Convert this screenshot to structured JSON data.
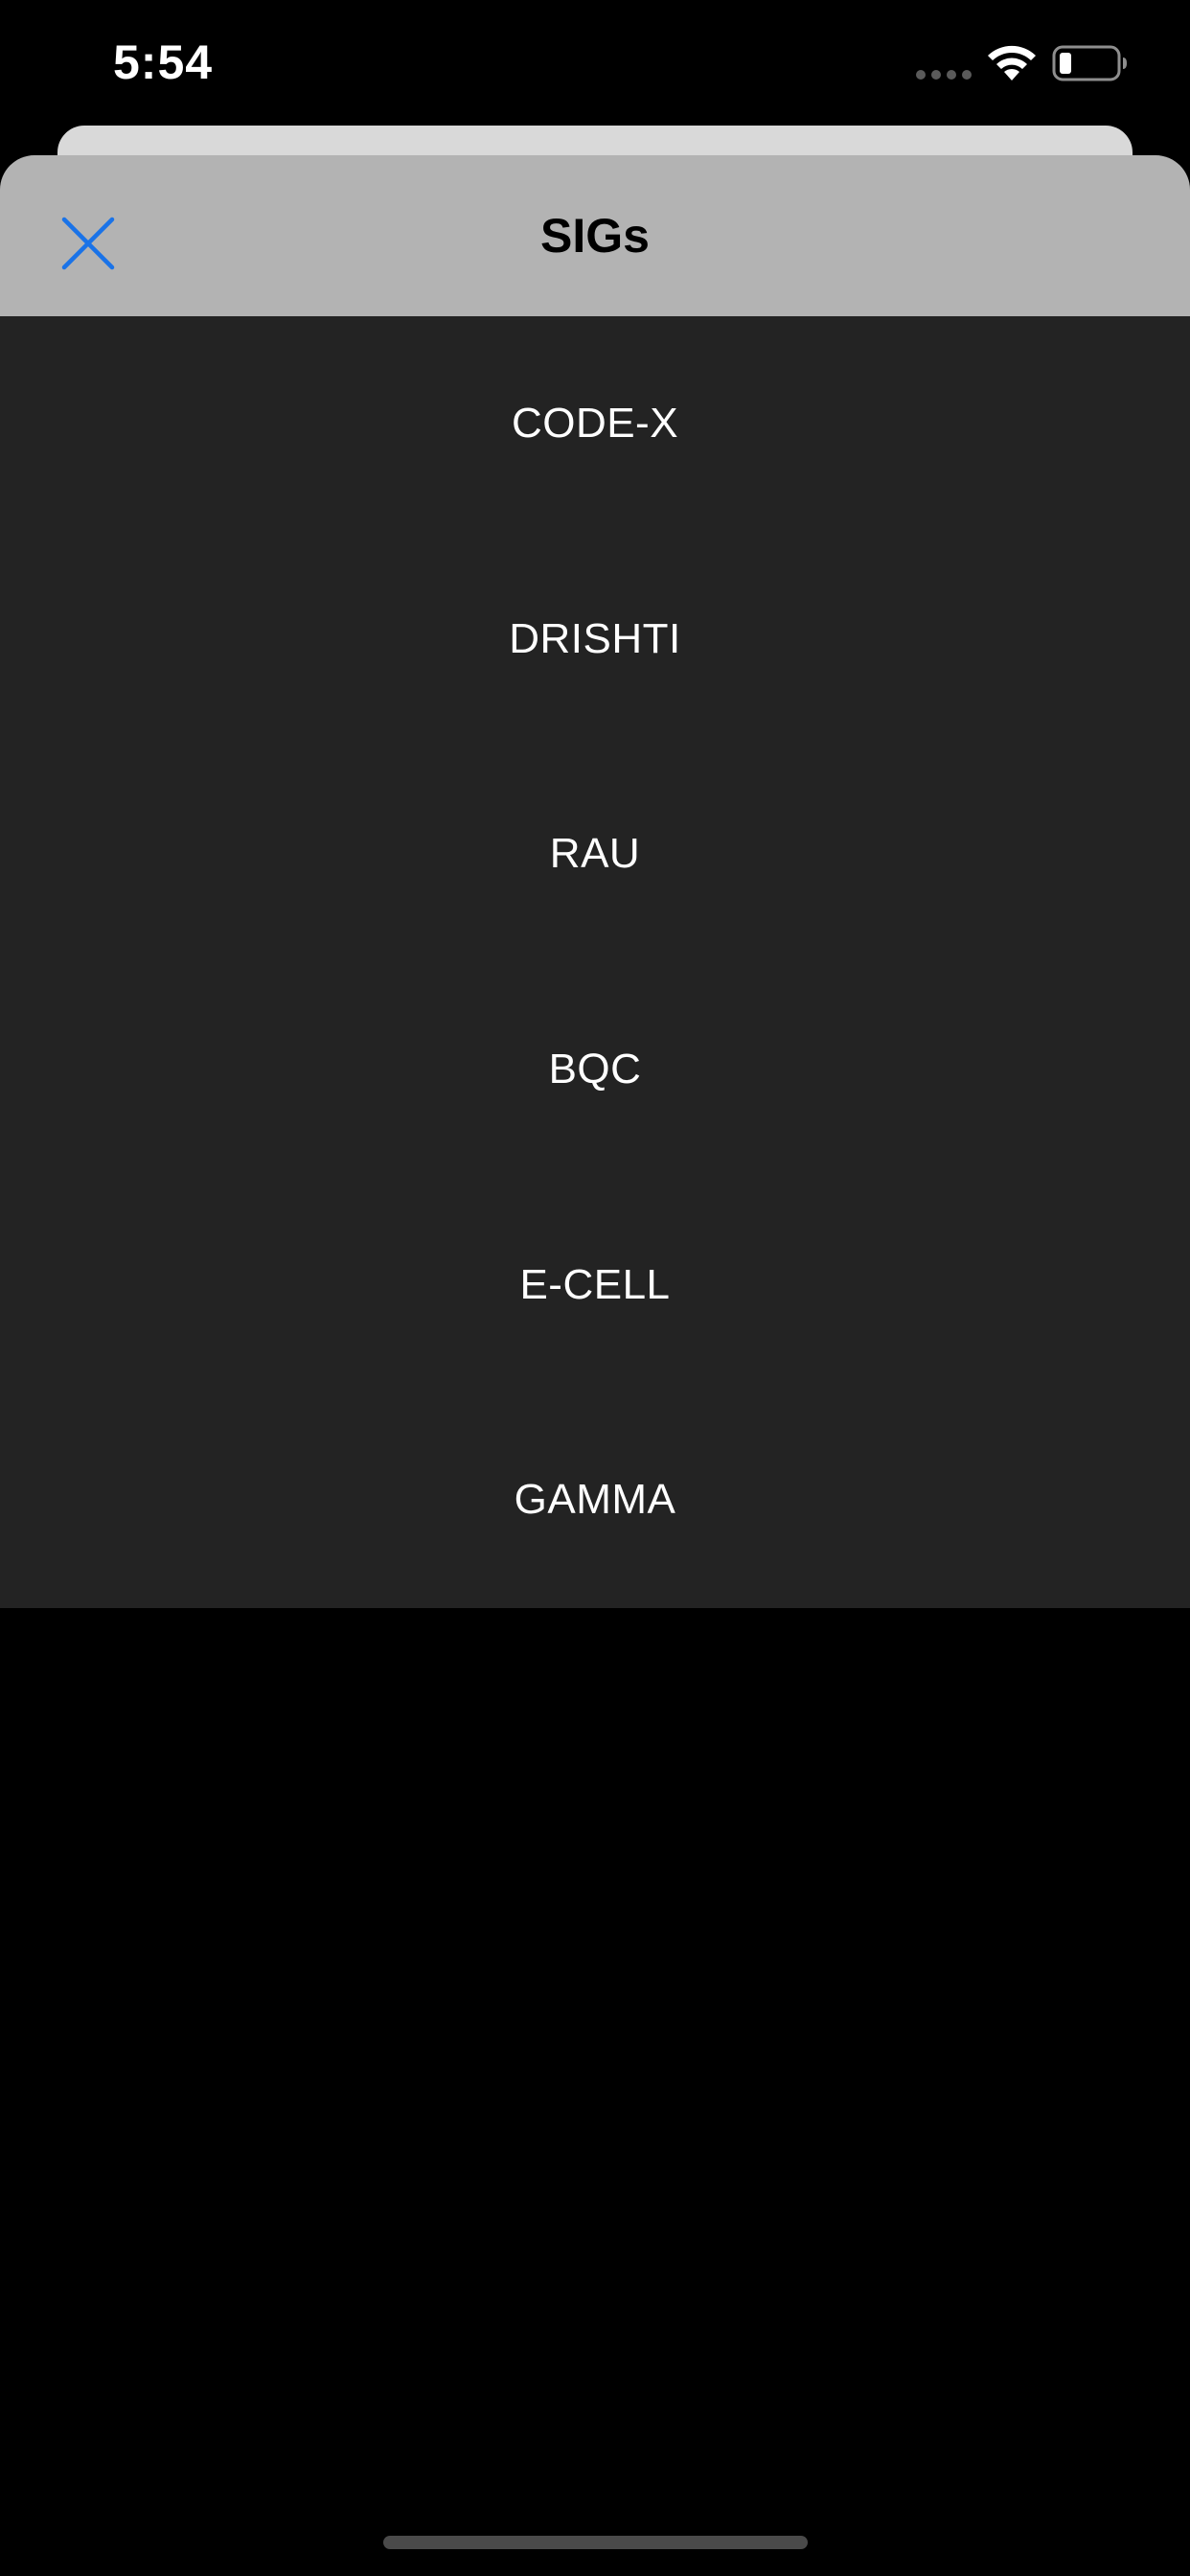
{
  "status_bar": {
    "time": "5:54",
    "signal_icon": "cellular-signal-dots-icon",
    "wifi_icon": "wifi-icon",
    "battery_icon": "battery-low-icon"
  },
  "sheet": {
    "title": "SIGs",
    "close_icon": "close-icon",
    "accent_color": "#1a73e8",
    "header_color": "#b3b3b3",
    "background_color": "#232323"
  },
  "sigs": {
    "items": [
      {
        "label": "CODE-X"
      },
      {
        "label": "DRISHTI"
      },
      {
        "label": "RAU"
      },
      {
        "label": "BQC"
      },
      {
        "label": "E-CELL"
      },
      {
        "label": "GAMMA"
      }
    ]
  }
}
